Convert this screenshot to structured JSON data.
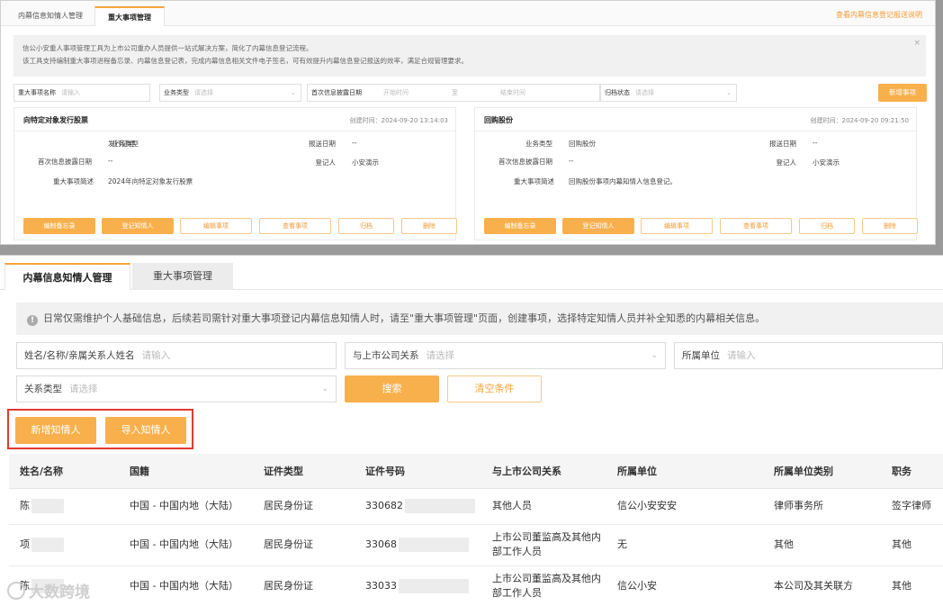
{
  "top": {
    "tabs": [
      "内幕信息知情人管理",
      "重大事项管理"
    ],
    "help_link": "查看内幕信息登记报送说明",
    "notice": [
      "信公小安重人事项管理工具为上市公司重办人员提供一站式解决方案，简化了内幕信息登记流程。",
      "该工具支持编制重大事项进程备忘录、内幕信息登记表，完成内幕信息相关文件电子签名，可有效提升内幕信息登记报送的效率，满足合规管理要求。"
    ],
    "close": "×",
    "filters": {
      "name_label": "重大事项名称",
      "name_ph": "请输入",
      "type_label": "业务类型",
      "type_ph": "请选择",
      "date_label": "首次信息披露日期",
      "date_start": "开始时间",
      "date_sep": "至",
      "date_end": "结束时间",
      "status_label": "归档状态",
      "status_ph": "请选择"
    },
    "add_button": "新增事项",
    "cards": [
      {
        "title": "向特定对象发行股票",
        "time": "创建时间：2024-09-20 13:14:03",
        "biz_type_label": "业务类型",
        "biz_type": "发行证券",
        "report_date_label": "报送日期",
        "report_date": "--",
        "first_date_label": "首次信息披露日期",
        "first_date": "--",
        "registrant_label": "登记人",
        "registrant": "小安演示",
        "desc_label": "重大事项简述",
        "desc": "2024年向特定对象发行股票",
        "buttons": [
          "编制备忘录",
          "登记知情人",
          "编辑事项",
          "查看事项",
          "归档",
          "删除"
        ]
      },
      {
        "title": "回购股份",
        "time": "创建时间：2024-09-20 09:21:50",
        "biz_type_label": "业务类型",
        "biz_type": "回购股份",
        "report_date_label": "报送日期",
        "report_date": "--",
        "first_date_label": "首次信息披露日期",
        "first_date": "--",
        "registrant_label": "登记人",
        "registrant": "小安演示",
        "desc_label": "重大事项简述",
        "desc": "回购股份事项内幕知情人信息登记。",
        "buttons": [
          "编制备忘录",
          "登记知情人",
          "编辑事项",
          "查看事项",
          "归档",
          "删除"
        ]
      }
    ]
  },
  "bottom": {
    "tabs": [
      "内幕信息知情人管理",
      "重大事项管理"
    ],
    "notice": "日常仅需维护个人基础信息，后续若司需针对重大事项登记内幕信息知情人时，请至\"重大事项管理\"页面，创建事项，选择特定知情人员并补全知悉的内幕相关信息。",
    "filters": {
      "name_label": "姓名/名称/亲属关系人姓名",
      "name_ph": "请输入",
      "relation_label": "与上市公司关系",
      "relation_ph": "请选择",
      "org_label": "所属单位",
      "org_ph": "请输入",
      "rel_type_label": "关系类型",
      "rel_type_ph": "请选择"
    },
    "search_button": "搜索",
    "clear_button": "清空条件",
    "new_button": "新增知情人",
    "import_button": "导入知情人",
    "table": {
      "headers": [
        "姓名/名称",
        "国籍",
        "证件类型",
        "证件号码",
        "与上市公司关系",
        "所属单位",
        "所属单位类别",
        "职务"
      ],
      "rows": [
        [
          "陈",
          "中国 - 中国内地（大陆）",
          "居民身份证",
          "330682",
          "其他人员",
          "信公小安安安",
          "律师事务所",
          "签字律师"
        ],
        [
          "项",
          "中国 - 中国内地（大陆）",
          "居民身份证",
          "33068",
          "上市公司董监高及其他内部工作人员",
          "无",
          "其他",
          "其他"
        ],
        [
          "陈",
          "中国 - 中国内地（大陆）",
          "居民身份证",
          "33033",
          "上市公司董监高及其他内部工作人员",
          "信公小安",
          "本公司及其关联方",
          "其他"
        ]
      ]
    }
  },
  "watermark": "大数跨境"
}
